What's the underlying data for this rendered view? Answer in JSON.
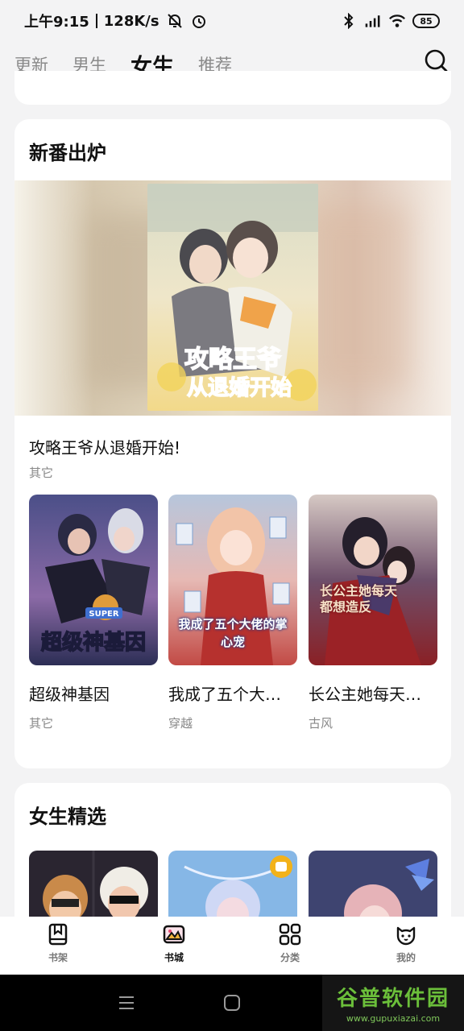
{
  "status": {
    "time": "上午9:15",
    "speed": "128K/s",
    "battery": "85",
    "icons": [
      "mute-icon",
      "alarm-icon",
      "bluetooth-icon",
      "hd-signal-icon",
      "wifi-icon",
      "battery-icon"
    ]
  },
  "topnav": {
    "tabs": [
      {
        "label": "更新"
      },
      {
        "label": "男生"
      },
      {
        "label": "女生"
      },
      {
        "label": "推荐"
      }
    ],
    "active_tab": "女生"
  },
  "new_section": {
    "title": "新番出炉",
    "hero": {
      "title": "攻略王爷从退婚开始!",
      "genre": "其它",
      "cover_text": [
        "攻略王爷",
        "从退婚开始"
      ]
    },
    "books": [
      {
        "name": "超级神基因",
        "genre": "其它",
        "cover_text": "超级神基因",
        "cover_badge": "SUPER"
      },
      {
        "name": "我成了五个大…",
        "genre": "穿越",
        "cover_text": "我成了五个大佬的掌心宠"
      },
      {
        "name": "长公主她每天…",
        "genre": "古风",
        "cover_text": "长公主她每天都想造反"
      }
    ]
  },
  "girls_section": {
    "title": "女生精选"
  },
  "bottomnav": {
    "items": [
      {
        "label": "书架",
        "icon": "bookshelf-icon"
      },
      {
        "label": "书城",
        "icon": "bookstore-icon"
      },
      {
        "label": "分类",
        "icon": "category-icon"
      },
      {
        "label": "我的",
        "icon": "profile-icon"
      }
    ],
    "active": "书城"
  },
  "watermark": {
    "title": "谷普软件园",
    "url": "www.gupuxiazai.com"
  },
  "colors": {
    "accent": "#111111",
    "inactive": "#8a8a8a",
    "background": "#f3f3f4",
    "watermark_green": "#6bbf3a"
  }
}
